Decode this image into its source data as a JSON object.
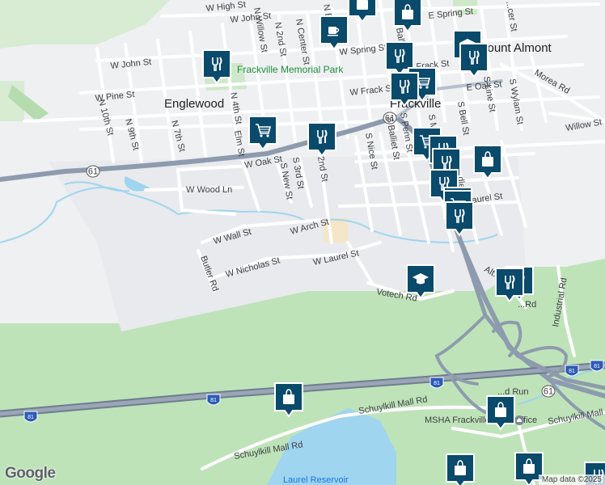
{
  "map": {
    "attribution": "Map data ©2025",
    "logo": "Google",
    "areas": {
      "englewood": "Englewood",
      "frackville": "Frackville",
      "mount_almont": "Mount Almont"
    },
    "park": "Frackville Memorial Park",
    "water": "Laurel Reservoir",
    "place": "MSHA Frackville Field Office",
    "shields": {
      "route61a": "61",
      "route61b": "61",
      "route61c": "61",
      "i81a": "81",
      "i81b": "81",
      "i81c": "81",
      "i81d": "81",
      "i81e": "81"
    },
    "streets": {
      "w_high": "W High St",
      "w_john_top": "W John St",
      "w_john": "W John St",
      "w_pine": "W Pine St",
      "n_10th": "N 10th St",
      "n_9th": "N 9th St",
      "n_7th": "N 7th St",
      "n_4th": "N 4th St",
      "elm": "Elm St",
      "n_willow": "N Willow St",
      "n_2nd": "N 2nd St",
      "n_center": "N Center St",
      "n_b": "N B...",
      "w_spring": "W Spring St",
      "e_spring": "E Spring St",
      "ballet_n": "Ballet St",
      "w_frack": "W Frack St",
      "frack": "Frack St",
      "e_oak": "E Oak St",
      "w_oak": "W Oak St",
      "morea": "Morea Rd",
      "willow": "Willow St",
      "s_line": "S Line St",
      "s_wylam": "S Wylam St",
      "s_bell": "S Bell St",
      "s_nice": "S Nice St",
      "s_balliet": "S Balliet St",
      "s_penn": "S Penn St",
      "s_m": "S M...",
      "s_3rd": "S 3rd St",
      "s_new": "S New St",
      "s_2nd": "2nd St",
      "w_wood": "W Wood Ln",
      "w_wall": "W Wall St",
      "w_arch": "W Arch St",
      "w_nicholas": "W Nicholas St",
      "w_laurel": "W Laurel St",
      "laurel": "Laurel St",
      "butler": "Butler Rd",
      "votech": "Votech Rd",
      "industrial": "Industrial Rd",
      "schuylkill1": "Schuylkill Mall Rd",
      "schuylkill2": "Schuylkill Mall Rd",
      "run": "...d Run",
      "middle": "...dle St",
      "cer": "...cer St",
      "alt": "Alt...",
      "rd": "...Rd"
    }
  },
  "markers": [
    {
      "id": "restaurant",
      "type": "restaurant",
      "icon": "fork-knife-icon"
    },
    {
      "id": "cafe",
      "type": "cafe",
      "icon": "coffee-cup-icon"
    },
    {
      "id": "shopping",
      "type": "shopping",
      "icon": "shopping-bag-icon"
    },
    {
      "id": "grocery",
      "type": "grocery",
      "icon": "shopping-cart-icon"
    },
    {
      "id": "school",
      "type": "school",
      "icon": "graduation-cap-icon"
    }
  ],
  "colors": {
    "land": "#eef0f2",
    "road": "#ffffff",
    "road_casing": "#d0d4d8",
    "highway": "#8e9bae",
    "highway_casing": "#6f7d90",
    "park": "#cfe8c9",
    "green": "#b9dfb3",
    "water": "#9fd5ee",
    "marker": "#0a4a6b",
    "marker_border": "#ffffff"
  }
}
